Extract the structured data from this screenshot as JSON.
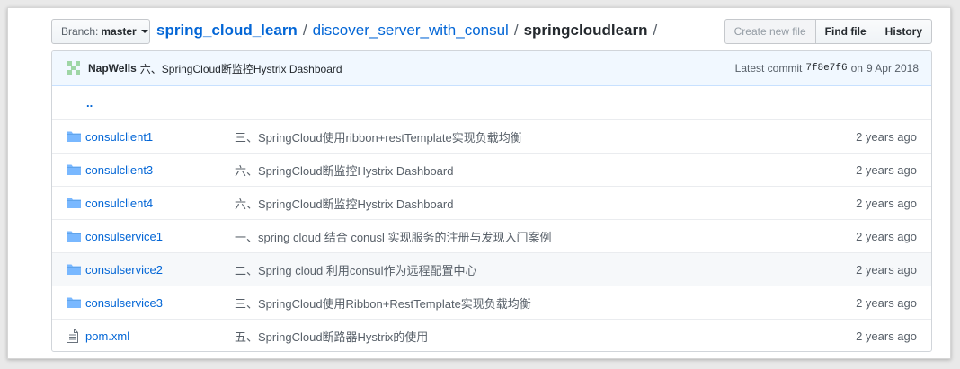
{
  "branch": {
    "label": "Branch:",
    "value": "master"
  },
  "breadcrumb": {
    "repo": "spring_cloud_learn",
    "path1": "discover_server_with_consul",
    "current": "springcloudlearn",
    "separator": "/"
  },
  "actions": {
    "create": "Create new file",
    "find": "Find file",
    "history": "History"
  },
  "commit": {
    "author": "NapWells",
    "message": "六、SpringCloud断监控Hystrix Dashboard",
    "latest_label": "Latest commit",
    "sha": "7f8e7f6",
    "on": "on",
    "date": "9 Apr 2018"
  },
  "parent_link": "..",
  "colors": {
    "link": "#0366d6",
    "folder": "#79b8ff",
    "commit_bg": "#f1f8ff"
  },
  "files": [
    {
      "icon": "folder-icon",
      "name": "consulclient1",
      "message": "三、SpringCloud使用ribbon+restTemplate实现负载均衡",
      "age": "2 years ago"
    },
    {
      "icon": "folder-icon",
      "name": "consulclient3",
      "message": "六、SpringCloud断监控Hystrix Dashboard",
      "age": "2 years ago"
    },
    {
      "icon": "folder-icon",
      "name": "consulclient4",
      "message": "六、SpringCloud断监控Hystrix Dashboard",
      "age": "2 years ago"
    },
    {
      "icon": "folder-icon",
      "name": "consulservice1",
      "message": "一、spring cloud 结合 conusl 实现服务的注册与发现入门案例",
      "age": "2 years ago"
    },
    {
      "icon": "folder-icon",
      "name": "consulservice2",
      "message": "二、Spring cloud 利用consul作为远程配置中心",
      "age": "2 years ago"
    },
    {
      "icon": "folder-icon",
      "name": "consulservice3",
      "message": "三、SpringCloud使用Ribbon+RestTemplate实现负载均衡",
      "age": "2 years ago"
    },
    {
      "icon": "file-icon",
      "name": "pom.xml",
      "message": "五、SpringCloud断路器Hystrix的使用",
      "age": "2 years ago"
    }
  ]
}
